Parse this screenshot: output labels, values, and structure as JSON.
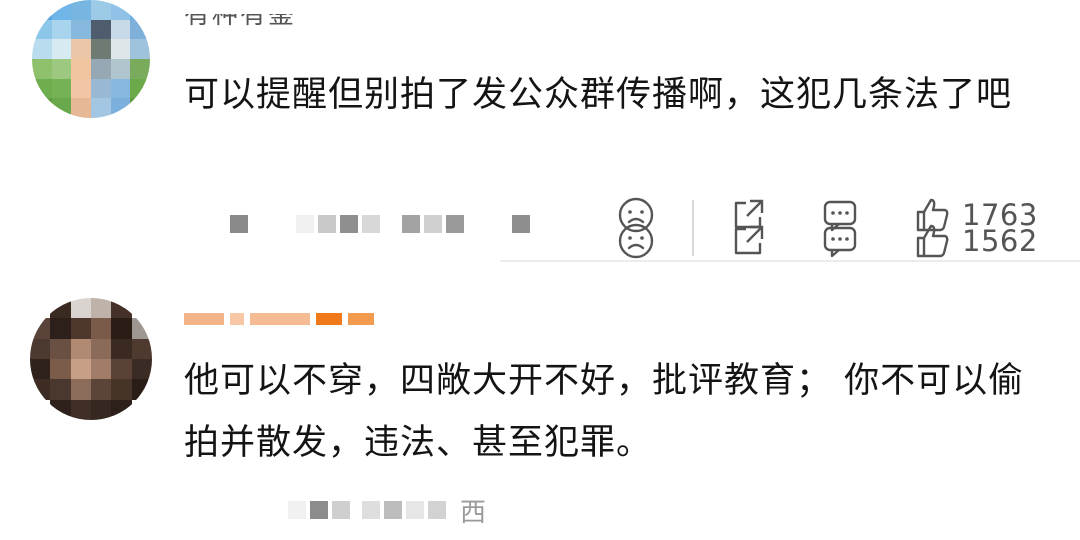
{
  "comments": [
    {
      "username": "有种有鉴",
      "text": "可以提醒但别拍了发公众群传播啊，这犯几条法了吧",
      "likes": "1763",
      "actions": [
        "frown-icon",
        "share-icon",
        "comment-icon",
        "like-icon"
      ]
    },
    {
      "username": "",
      "text": "他可以不穿，四敞大开不好，批评教育； 你不可以偷拍并散发，违法、甚至犯罪。",
      "region": "西",
      "likes": "1562",
      "actions": [
        "frown-icon",
        "share-icon",
        "comment-icon",
        "like-icon"
      ]
    }
  ],
  "colors": {
    "text": "#141414",
    "meta": "#9a9a9a",
    "icon": "#555555",
    "username_accent": "#f07a1a"
  }
}
